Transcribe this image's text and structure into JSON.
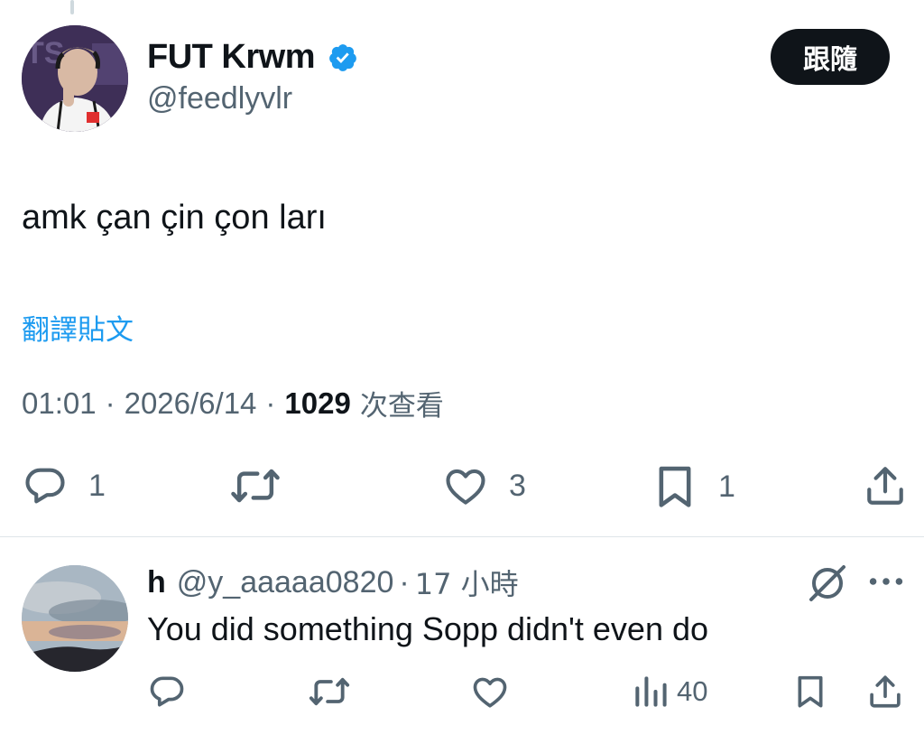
{
  "tweet": {
    "author": {
      "name": "FUT Krwm",
      "handle": "@feedlyvlr",
      "verified": true
    },
    "follow_label": "跟隨",
    "text": "amk çan çin çon ları",
    "translate_label": "翻譯貼文",
    "meta": {
      "time": "01:01",
      "date": "2026/6/14",
      "views": "1029",
      "views_label": "次查看",
      "separator": "·"
    },
    "actions": {
      "replies": "1",
      "retweets": "",
      "likes": "3",
      "bookmarks": "1"
    }
  },
  "reply": {
    "author_name": "h",
    "handle": "@y_aaaaa0820",
    "separator": "·",
    "time": "17 小時",
    "text": "You did something Sopp didn't even do",
    "actions": {
      "views": "40"
    }
  },
  "colors": {
    "text": "#0f1419",
    "secondary": "#536471",
    "link": "#1d9bf0",
    "verified": "#1d9bf0",
    "button_bg": "#0f1419"
  },
  "icons": {
    "reply": "reply-icon",
    "retweet": "retweet-icon",
    "like": "heart-icon",
    "bookmark": "bookmark-icon",
    "share": "share-icon",
    "views": "views-chart-icon",
    "grok": "grok-icon",
    "more": "more-icon",
    "verified": "verified-badge-icon"
  }
}
